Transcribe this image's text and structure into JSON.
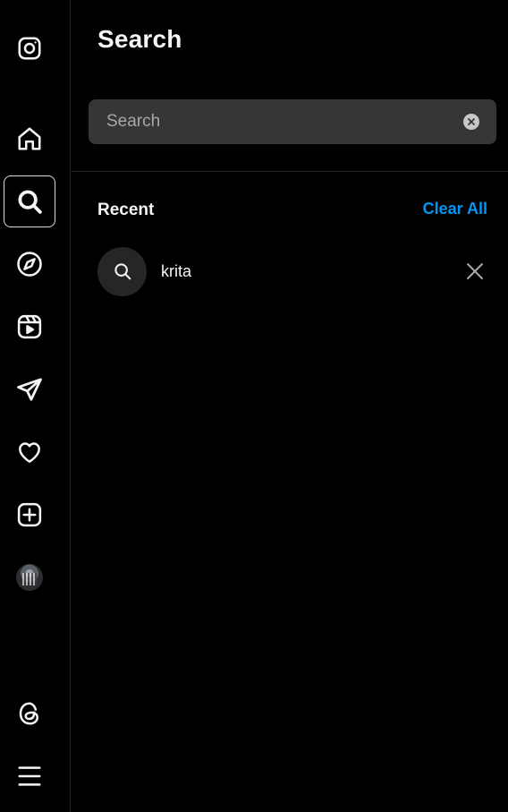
{
  "sidebar": {
    "items": [
      {
        "name": "instagram-logo-icon",
        "active": false
      },
      {
        "name": "home-icon",
        "active": false
      },
      {
        "name": "search-icon",
        "active": true
      },
      {
        "name": "explore-compass-icon",
        "active": false
      },
      {
        "name": "reels-icon",
        "active": false
      },
      {
        "name": "messages-send-icon",
        "active": false
      },
      {
        "name": "notifications-heart-icon",
        "active": false
      },
      {
        "name": "create-plus-icon",
        "active": false
      },
      {
        "name": "profile-avatar",
        "active": false
      },
      {
        "name": "threads-icon",
        "active": false
      },
      {
        "name": "more-menu-icon",
        "active": false
      }
    ]
  },
  "search": {
    "title": "Search",
    "placeholder": "Search",
    "value": ""
  },
  "recent": {
    "heading": "Recent",
    "clear_all_label": "Clear All",
    "items": [
      {
        "query": "krita"
      }
    ]
  },
  "colors": {
    "background": "#000000",
    "input_bg": "#363636",
    "accent": "#0095f6",
    "divider": "#262626"
  }
}
